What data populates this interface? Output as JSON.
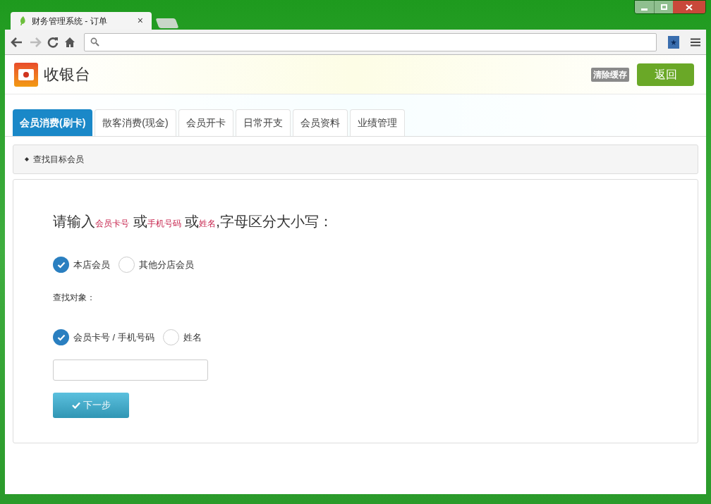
{
  "browser": {
    "tab_title": "财务管理系统 - 订单",
    "close": "×"
  },
  "header": {
    "title": "收银台",
    "clear_cache": "清除缓存",
    "back": "返回"
  },
  "tabs": [
    {
      "label": "会员消费(刷卡)",
      "selected": true
    },
    {
      "label": "散客消费(现金)",
      "selected": false
    },
    {
      "label": "会员开卡",
      "selected": false
    },
    {
      "label": "日常开支",
      "selected": false
    },
    {
      "label": "会员资料",
      "selected": false
    },
    {
      "label": "业绩管理",
      "selected": false
    }
  ],
  "panel_heading": "查找目标会员",
  "prompt": [
    {
      "kind": "plain",
      "text": "请输入"
    },
    {
      "kind": "highlight",
      "text": "会员卡号"
    },
    {
      "kind": "plain",
      "text": " 或"
    },
    {
      "kind": "highlight",
      "text": "手机号码"
    },
    {
      "kind": "plain",
      "text": " 或"
    },
    {
      "kind": "highlight",
      "text": "姓名"
    },
    {
      "kind": "plain",
      "text": ",字母区分大小写："
    }
  ],
  "store_options": [
    {
      "label": "本店会员",
      "selected": true
    },
    {
      "label": "其他分店会员",
      "selected": false
    }
  ],
  "target_label": "查找对象：",
  "target_options": [
    {
      "label": "会员卡号 / 手机号码",
      "selected": true
    },
    {
      "label": "姓名",
      "selected": false
    }
  ],
  "next_button": "下一步"
}
